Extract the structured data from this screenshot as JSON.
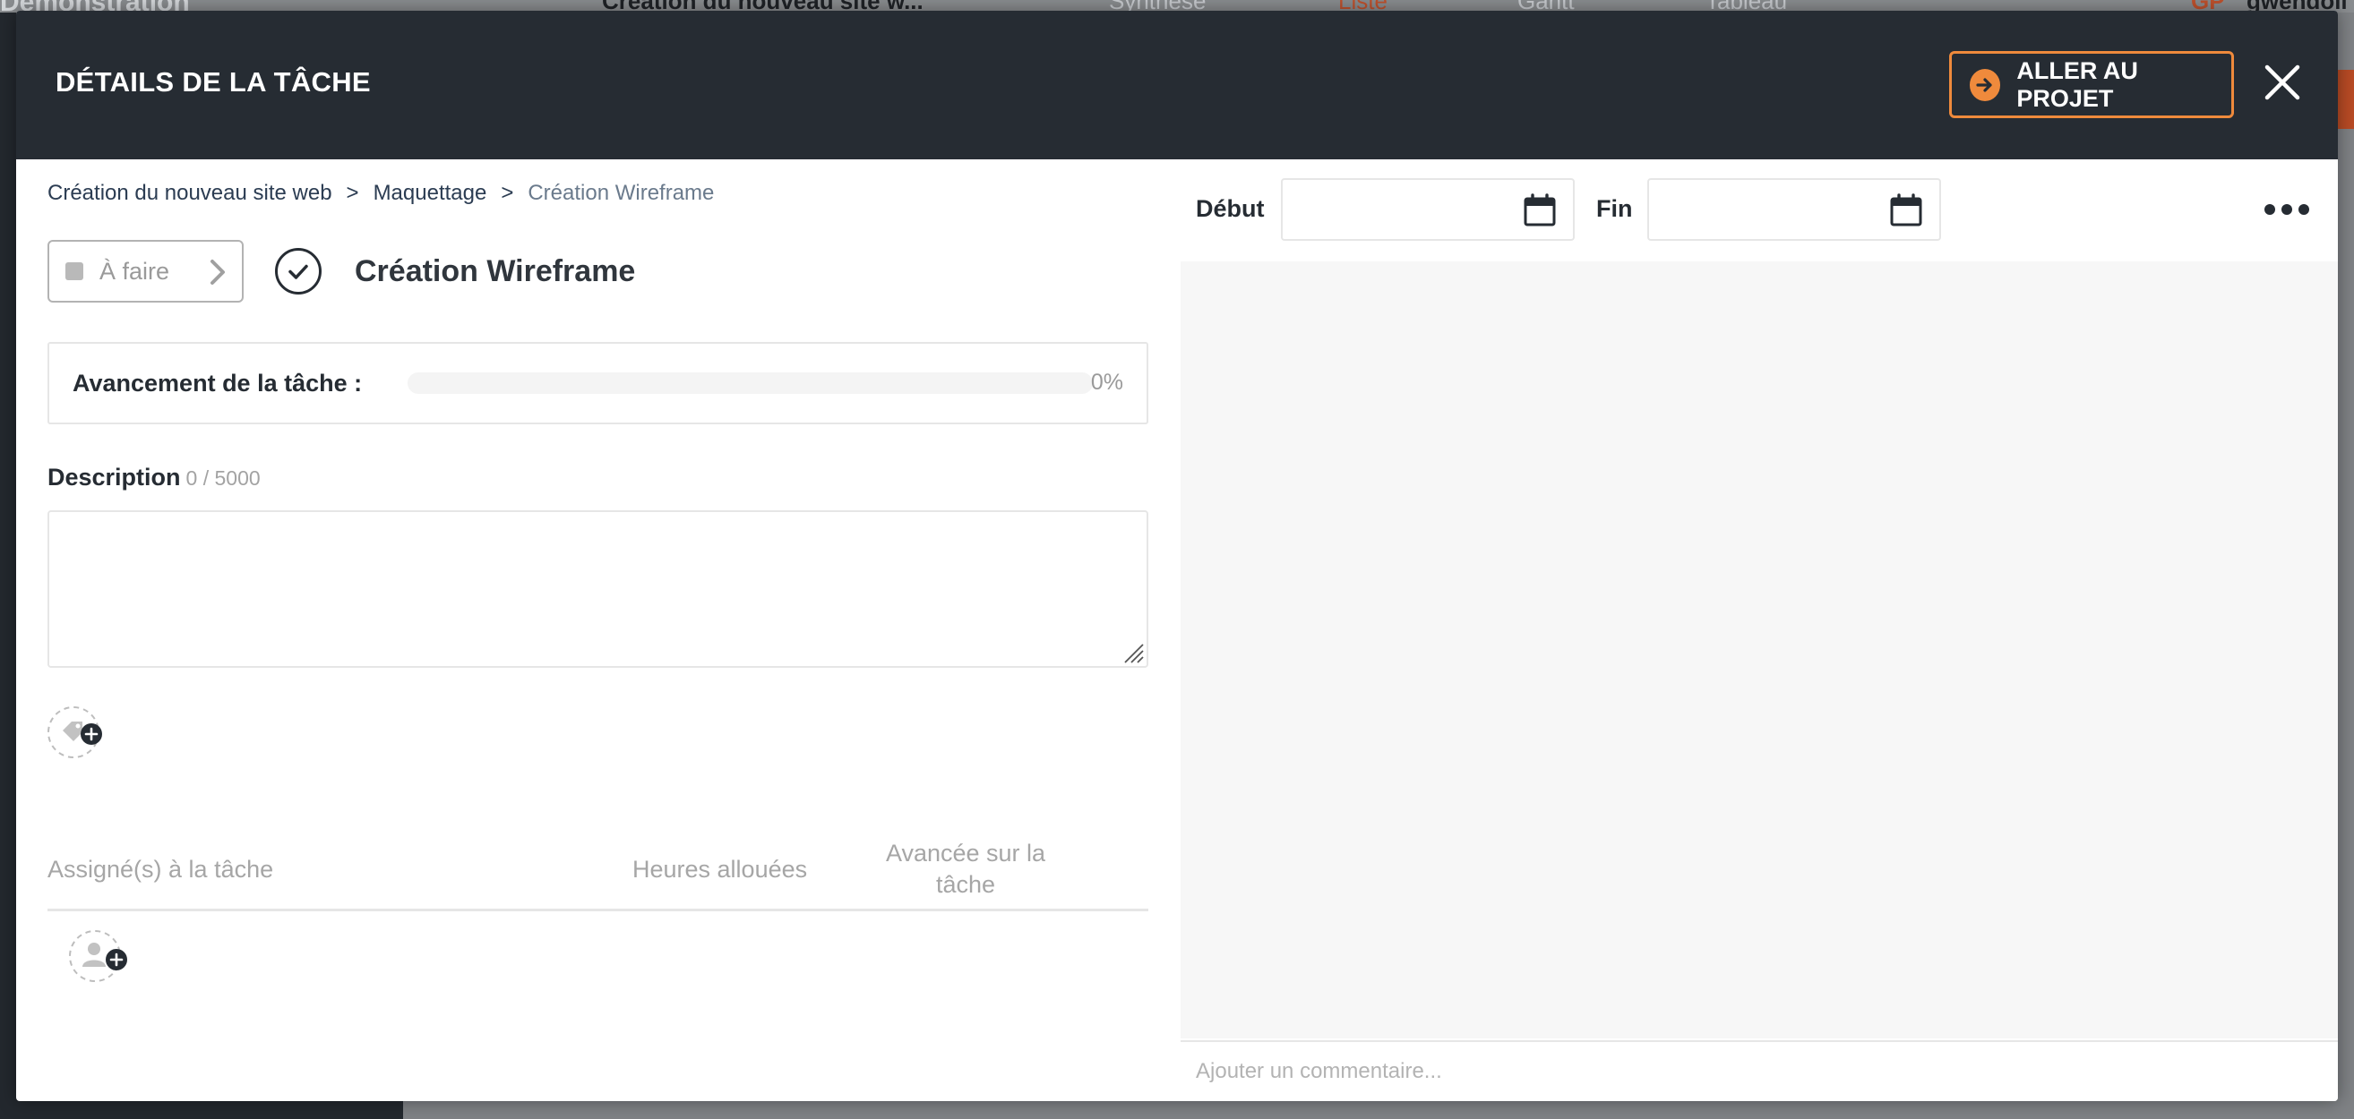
{
  "background": {
    "workspace_name": "Démonstration",
    "project_selector": "Création du nouveau site w...",
    "view_tabs": [
      "Synthèse",
      "Liste",
      "Gantt",
      "Tableau"
    ],
    "user_initials": "GP",
    "user_name": "gwendoli"
  },
  "modal": {
    "title": "DÉTAILS DE LA TÂCHE",
    "goto_project_label": "ALLER AU PROJET",
    "close_icon": "close-icon",
    "accent_color": "#ef8a3c",
    "header_color": "#262c33"
  },
  "breadcrumb": {
    "project": "Création du nouveau site web",
    "separator": ">",
    "phase": "Maquettage",
    "task": "Création Wireframe"
  },
  "task": {
    "status": "À faire",
    "name": "Création Wireframe",
    "progress_label": "Avancement de la tâche :",
    "progress_percent": 0,
    "progress_text": "0%"
  },
  "description": {
    "label": "Description",
    "counter": "0 / 5000",
    "value": ""
  },
  "assignments": {
    "col_assignee": "Assigné(s) à la tâche",
    "col_hours": "Heures allouées",
    "col_progress": "Avancée sur la tâche",
    "rows": []
  },
  "dates": {
    "start_label": "Début",
    "start_value": "",
    "end_label": "Fin",
    "end_value": ""
  },
  "comments": {
    "placeholder": "Ajouter un commentaire..."
  }
}
